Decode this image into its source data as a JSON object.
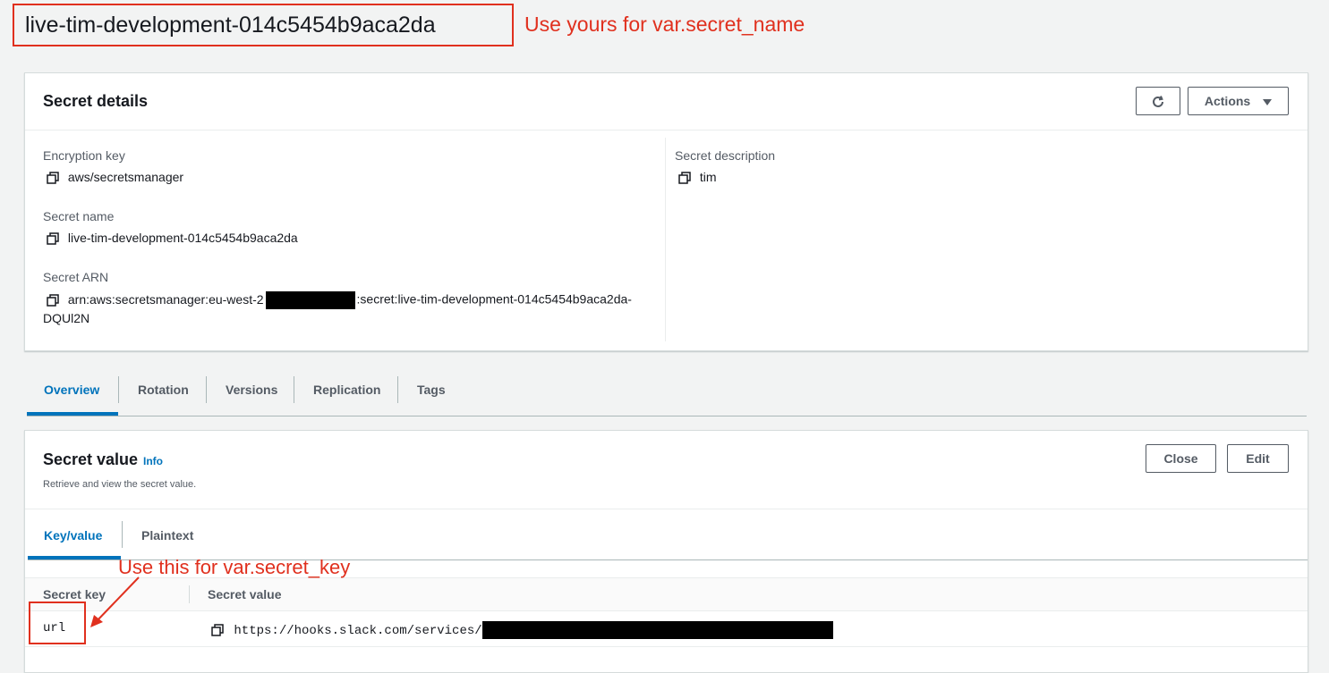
{
  "page_title": "live-tim-development-014c5454b9aca2da",
  "annotations": {
    "secret_name_note": "Use yours for var.secret_name",
    "secret_key_note": "Use this for var.secret_key"
  },
  "details": {
    "title": "Secret details",
    "actions_label": "Actions",
    "encryption_key_label": "Encryption key",
    "encryption_key_value": "aws/secretsmanager",
    "secret_name_label": "Secret name",
    "secret_name_value": "live-tim-development-014c5454b9aca2da",
    "secret_arn_label": "Secret ARN",
    "secret_arn_prefix": "arn:aws:secretsmanager:eu-west-2",
    "secret_arn_suffix": ":secret:live-tim-development-014c5454b9aca2da-",
    "secret_arn_wrap": "DQUl2N",
    "description_label": "Secret description",
    "description_value": "tim"
  },
  "tabs": [
    "Overview",
    "Rotation",
    "Versions",
    "Replication",
    "Tags"
  ],
  "secret_value": {
    "title": "Secret value",
    "info_label": "Info",
    "subtitle": "Retrieve and view the secret value.",
    "close_label": "Close",
    "edit_label": "Edit",
    "subtabs": [
      "Key/value",
      "Plaintext"
    ],
    "col_key": "Secret key",
    "col_value": "Secret value",
    "row_key": "url",
    "row_value_prefix": "https://hooks.slack.com/services/"
  },
  "colors": {
    "accent": "#0073bb",
    "annotation": "#e0301e",
    "page_bg": "#f2f3f3"
  }
}
